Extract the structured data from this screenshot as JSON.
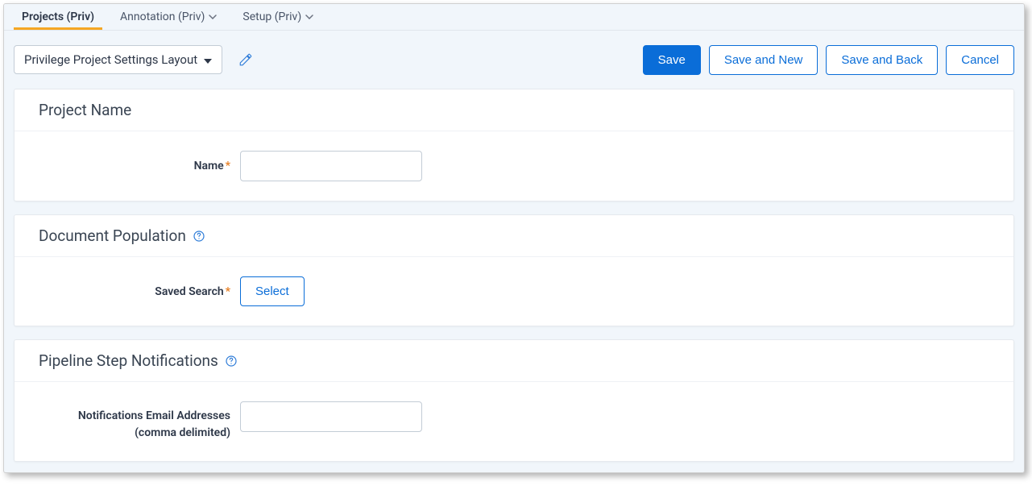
{
  "tabs": [
    {
      "label": "Projects (Priv)",
      "active": true,
      "hasChevron": false
    },
    {
      "label": "Annotation (Priv)",
      "active": false,
      "hasChevron": true
    },
    {
      "label": "Setup (Priv)",
      "active": false,
      "hasChevron": true
    }
  ],
  "layoutDropdown": {
    "selected": "Privilege Project Settings Layout"
  },
  "toolbar": {
    "save": "Save",
    "saveAndNew": "Save and New",
    "saveAndBack": "Save and Back",
    "cancel": "Cancel"
  },
  "panels": {
    "projectName": {
      "title": "Project Name",
      "fields": {
        "name": {
          "label": "Name",
          "required": true,
          "value": ""
        }
      }
    },
    "documentPopulation": {
      "title": "Document Population",
      "hasHelp": true,
      "fields": {
        "savedSearch": {
          "label": "Saved Search",
          "required": true,
          "selectLabel": "Select"
        }
      }
    },
    "pipelineNotifications": {
      "title": "Pipeline Step Notifications",
      "hasHelp": true,
      "fields": {
        "emails": {
          "labelLine1": "Notifications Email Addresses",
          "labelLine2": "(comma delimited)",
          "value": ""
        }
      }
    }
  }
}
